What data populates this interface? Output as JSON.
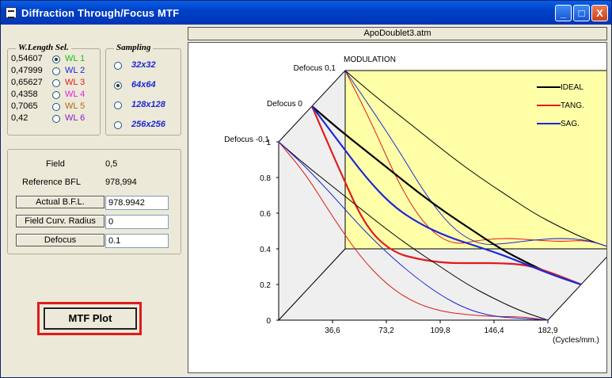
{
  "window": {
    "title": "Diffraction Through/Focus  MTF"
  },
  "titlebar_buttons": {
    "minimize": "_",
    "maximize": "□",
    "close": "X"
  },
  "wavelength": {
    "title": "W.Length Sel.",
    "items": [
      {
        "value": "0,54607",
        "name": "WL 1",
        "color": "#16c41a",
        "selected": true
      },
      {
        "value": "0,47999",
        "name": "WL 2",
        "color": "#1b28d6",
        "selected": false
      },
      {
        "value": "0,65627",
        "name": "WL 3",
        "color": "#e01b1b",
        "selected": false
      },
      {
        "value": "0,4358",
        "name": "WL 4",
        "color": "#e020e0",
        "selected": false
      },
      {
        "value": "0,7065",
        "name": "WL 5",
        "color": "#b06a14",
        "selected": false
      },
      {
        "value": "0,42",
        "name": "WL 6",
        "color": "#8a20c8",
        "selected": false
      }
    ]
  },
  "sampling": {
    "title": "Sampling",
    "items": [
      {
        "label": "32x32",
        "selected": false
      },
      {
        "label": "64x64",
        "selected": true
      },
      {
        "label": "128x128",
        "selected": false
      },
      {
        "label": "256x256",
        "selected": false
      }
    ]
  },
  "info": {
    "field_label": "Field",
    "field_value": "0,5",
    "ref_bfl_label": "Reference BFL",
    "ref_bfl_value": "978,994",
    "actual_bfl_label": "Actual  B.F.L.",
    "actual_bfl_value": "978.9942",
    "field_curv_label": "Field  Curv. Radius",
    "field_curv_value": "0",
    "defocus_label": "Defocus",
    "defocus_value": "0.1"
  },
  "mtf_button": "MTF Plot",
  "file_name": "ApoDoublet3.atm",
  "chart_data": {
    "type": "line",
    "title": "MODULATION",
    "x_unit_label": "(Cycles/mm.)",
    "x_ticks": [
      "36,6",
      "73,2",
      "109,8",
      "146,4",
      "182,9"
    ],
    "y_ticks": [
      "0",
      "0.2",
      "0.4",
      "0.6",
      "0.8",
      "1"
    ],
    "xlim": [
      0,
      182.9
    ],
    "ylim": [
      0,
      1
    ],
    "depth_labels": [
      "Defocus 0,1",
      "Defocus 0",
      "Defocus -0,1"
    ],
    "legend": [
      {
        "name": "IDEAL",
        "color": "#000000"
      },
      {
        "name": "TANG.",
        "color": "#e01b1b"
      },
      {
        "name": "SAG.",
        "color": "#1b28d6"
      }
    ],
    "legend_placement": "top-right",
    "panel_color": "#ffffa8",
    "x": [
      0,
      18.3,
      36.6,
      54.9,
      73.2,
      91.5,
      109.8,
      128.1,
      146.4,
      164.7,
      182.9
    ],
    "slices": [
      {
        "defocus": "Defocus 0,1",
        "ideal": [
          1.0,
          0.87,
          0.75,
          0.63,
          0.51,
          0.4,
          0.3,
          0.2,
          0.12,
          0.05,
          0.0
        ],
        "tang": [
          1.0,
          0.7,
          0.36,
          0.12,
          0.02,
          0.05,
          0.06,
          0.05,
          0.04,
          0.05,
          0.0
        ],
        "sag": [
          1.0,
          0.78,
          0.55,
          0.3,
          0.11,
          0.02,
          0.03,
          0.05,
          0.06,
          0.05,
          0.0
        ]
      },
      {
        "defocus": "Defocus 0",
        "ideal": [
          1.0,
          0.87,
          0.75,
          0.63,
          0.51,
          0.4,
          0.3,
          0.2,
          0.12,
          0.05,
          0.0
        ],
        "tang": [
          1.0,
          0.65,
          0.32,
          0.18,
          0.14,
          0.12,
          0.12,
          0.12,
          0.11,
          0.06,
          0.0
        ],
        "sag": [
          1.0,
          0.8,
          0.6,
          0.44,
          0.34,
          0.27,
          0.22,
          0.17,
          0.11,
          0.05,
          0.0
        ]
      },
      {
        "defocus": "Defocus -0,1",
        "ideal": [
          1.0,
          0.87,
          0.75,
          0.63,
          0.51,
          0.4,
          0.3,
          0.2,
          0.12,
          0.05,
          0.0
        ],
        "tang": [
          1.0,
          0.82,
          0.58,
          0.36,
          0.2,
          0.1,
          0.05,
          0.03,
          0.02,
          0.02,
          0.0
        ],
        "sag": [
          1.0,
          0.86,
          0.7,
          0.53,
          0.38,
          0.25,
          0.14,
          0.06,
          0.02,
          0.01,
          0.0
        ]
      }
    ]
  }
}
